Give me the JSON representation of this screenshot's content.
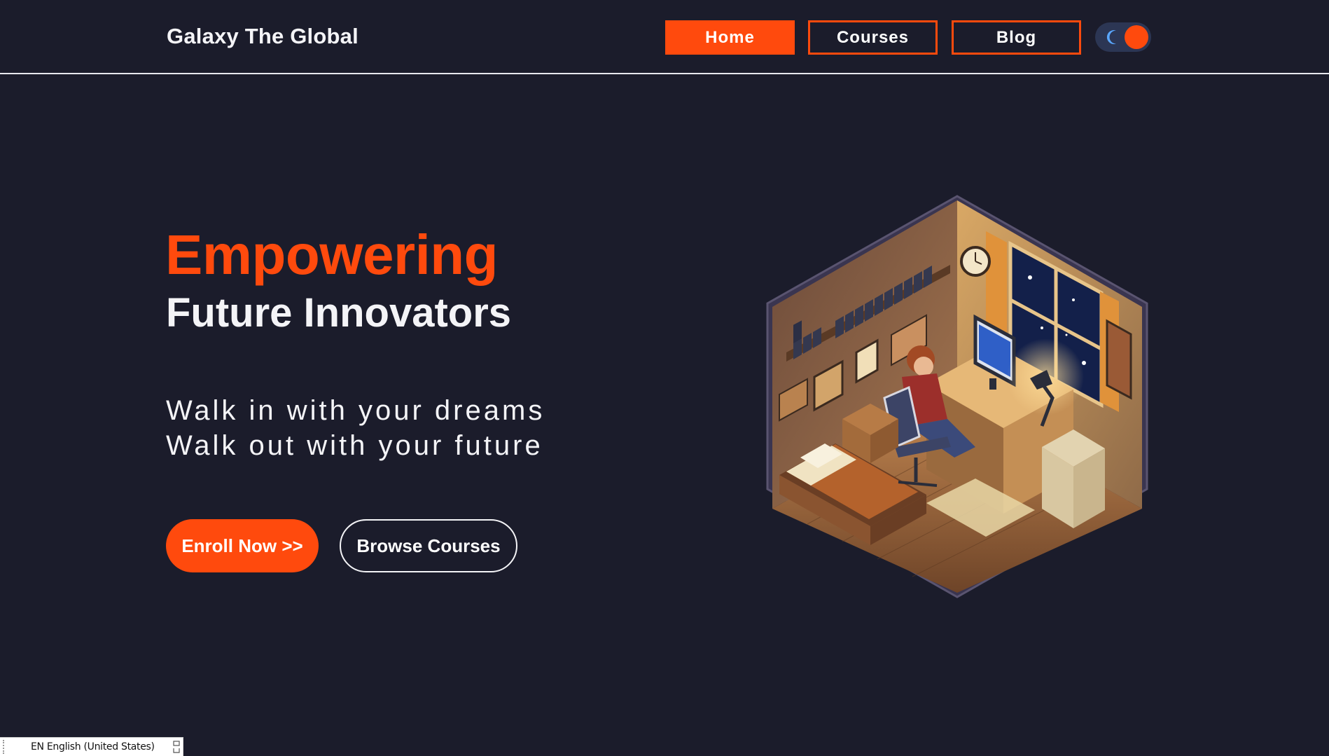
{
  "header": {
    "brand": "Galaxy The Global",
    "nav": {
      "home": "Home",
      "courses": "Courses",
      "blog": "Blog"
    },
    "active_nav": "Home",
    "theme_toggle": {
      "icon": "moon-icon",
      "state": "dark"
    }
  },
  "hero": {
    "title": "Empowering",
    "subtitle": "Future Innovators",
    "tagline_line1": "Walk in with your dreams",
    "tagline_line2": "Walk out with your future",
    "enroll_label": "Enroll Now >>",
    "browse_label": "Browse Courses",
    "illustration": "isometric-study-room-illustration"
  },
  "language_bar": {
    "label": "EN English (United States)"
  },
  "colors": {
    "background": "#1b1c2b",
    "accent": "#ff4a0d",
    "text": "#f4f4f7",
    "toggle_track": "#2c3654",
    "moon": "#5aa7ff"
  }
}
